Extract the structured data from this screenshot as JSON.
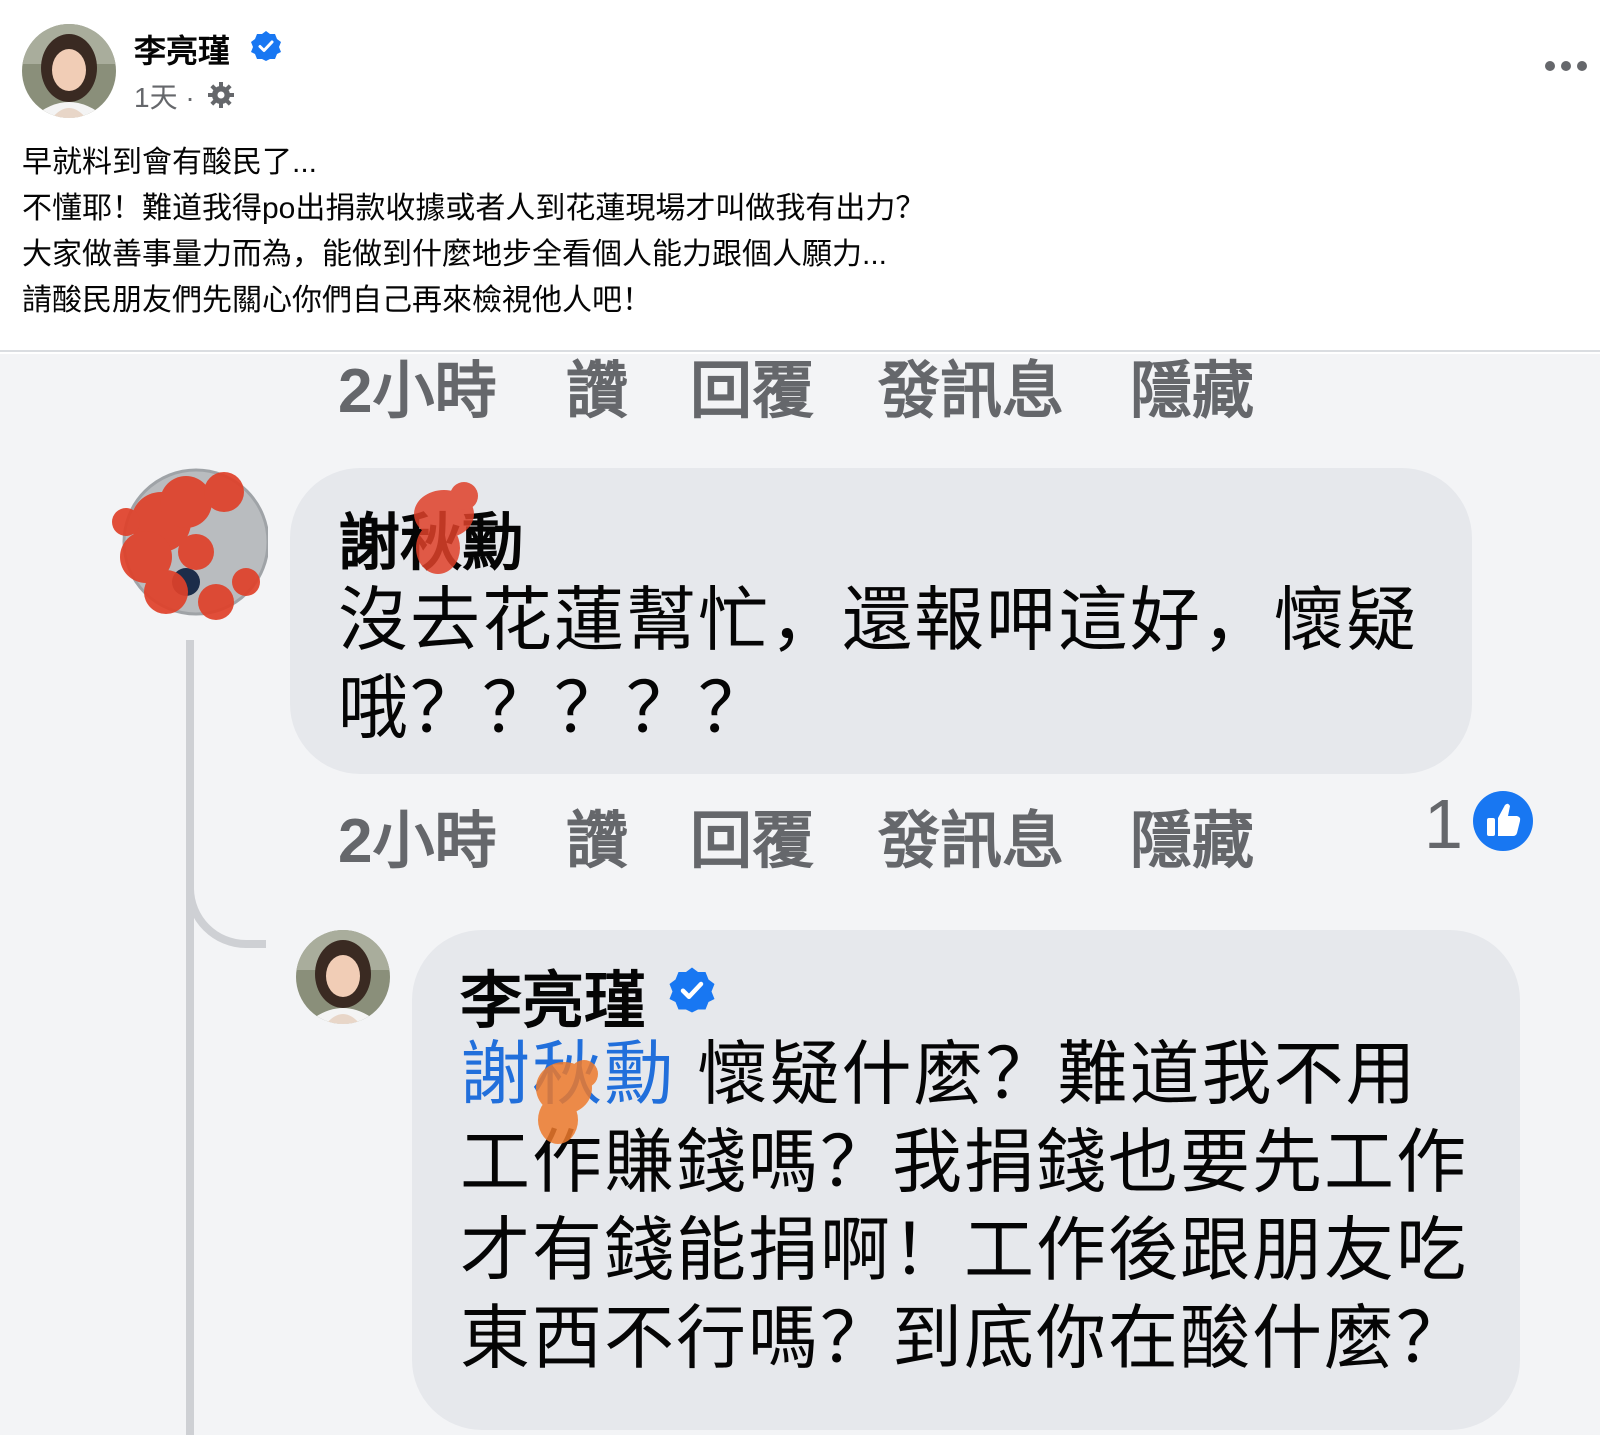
{
  "post": {
    "author": "李亮瑾",
    "time": "1天 ·",
    "body": [
      "早就料到會有酸民了...",
      "不懂耶！難道我得po出捐款收據或者人到花蓮現場才叫做我有出力？",
      "大家做善事量力而為，能做到什麼地步全看個人能力跟個人願力...",
      "請酸民朋友們先關心你們自己再來檢視他人吧！"
    ]
  },
  "actions_top": {
    "time": "2小時",
    "like": "讚",
    "reply": "回覆",
    "message": "發訊息",
    "hide": "隱藏"
  },
  "comment1": {
    "name": "謝秋勳",
    "lines": [
      "沒去花蓮幫忙，還報呷這好，懷疑",
      "哦？？？？？"
    ],
    "actions": {
      "time": "2小時",
      "like": "讚",
      "reply": "回覆",
      "message": "發訊息",
      "hide": "隱藏"
    },
    "like_count": "1"
  },
  "comment2": {
    "name": "李亮瑾",
    "mention": "謝秋勳",
    "line1_rest": " 懷疑什麼？難道我不用",
    "lines": [
      "工作賺錢嗎？我捐錢也要先工作",
      "才有錢能捐啊！工作後跟朋友吃",
      "東西不行嗎？到底你在酸什麼？"
    ]
  },
  "colors": {
    "verified": "#1877f2",
    "mention": "#216fdb",
    "bubble": "#e6e8ec",
    "secondary_text": "#65676b",
    "scribble": "#e0412a"
  },
  "icons": [
    "verified-badge-icon",
    "gear-icon",
    "more-options-icon",
    "like-thumb-icon"
  ]
}
